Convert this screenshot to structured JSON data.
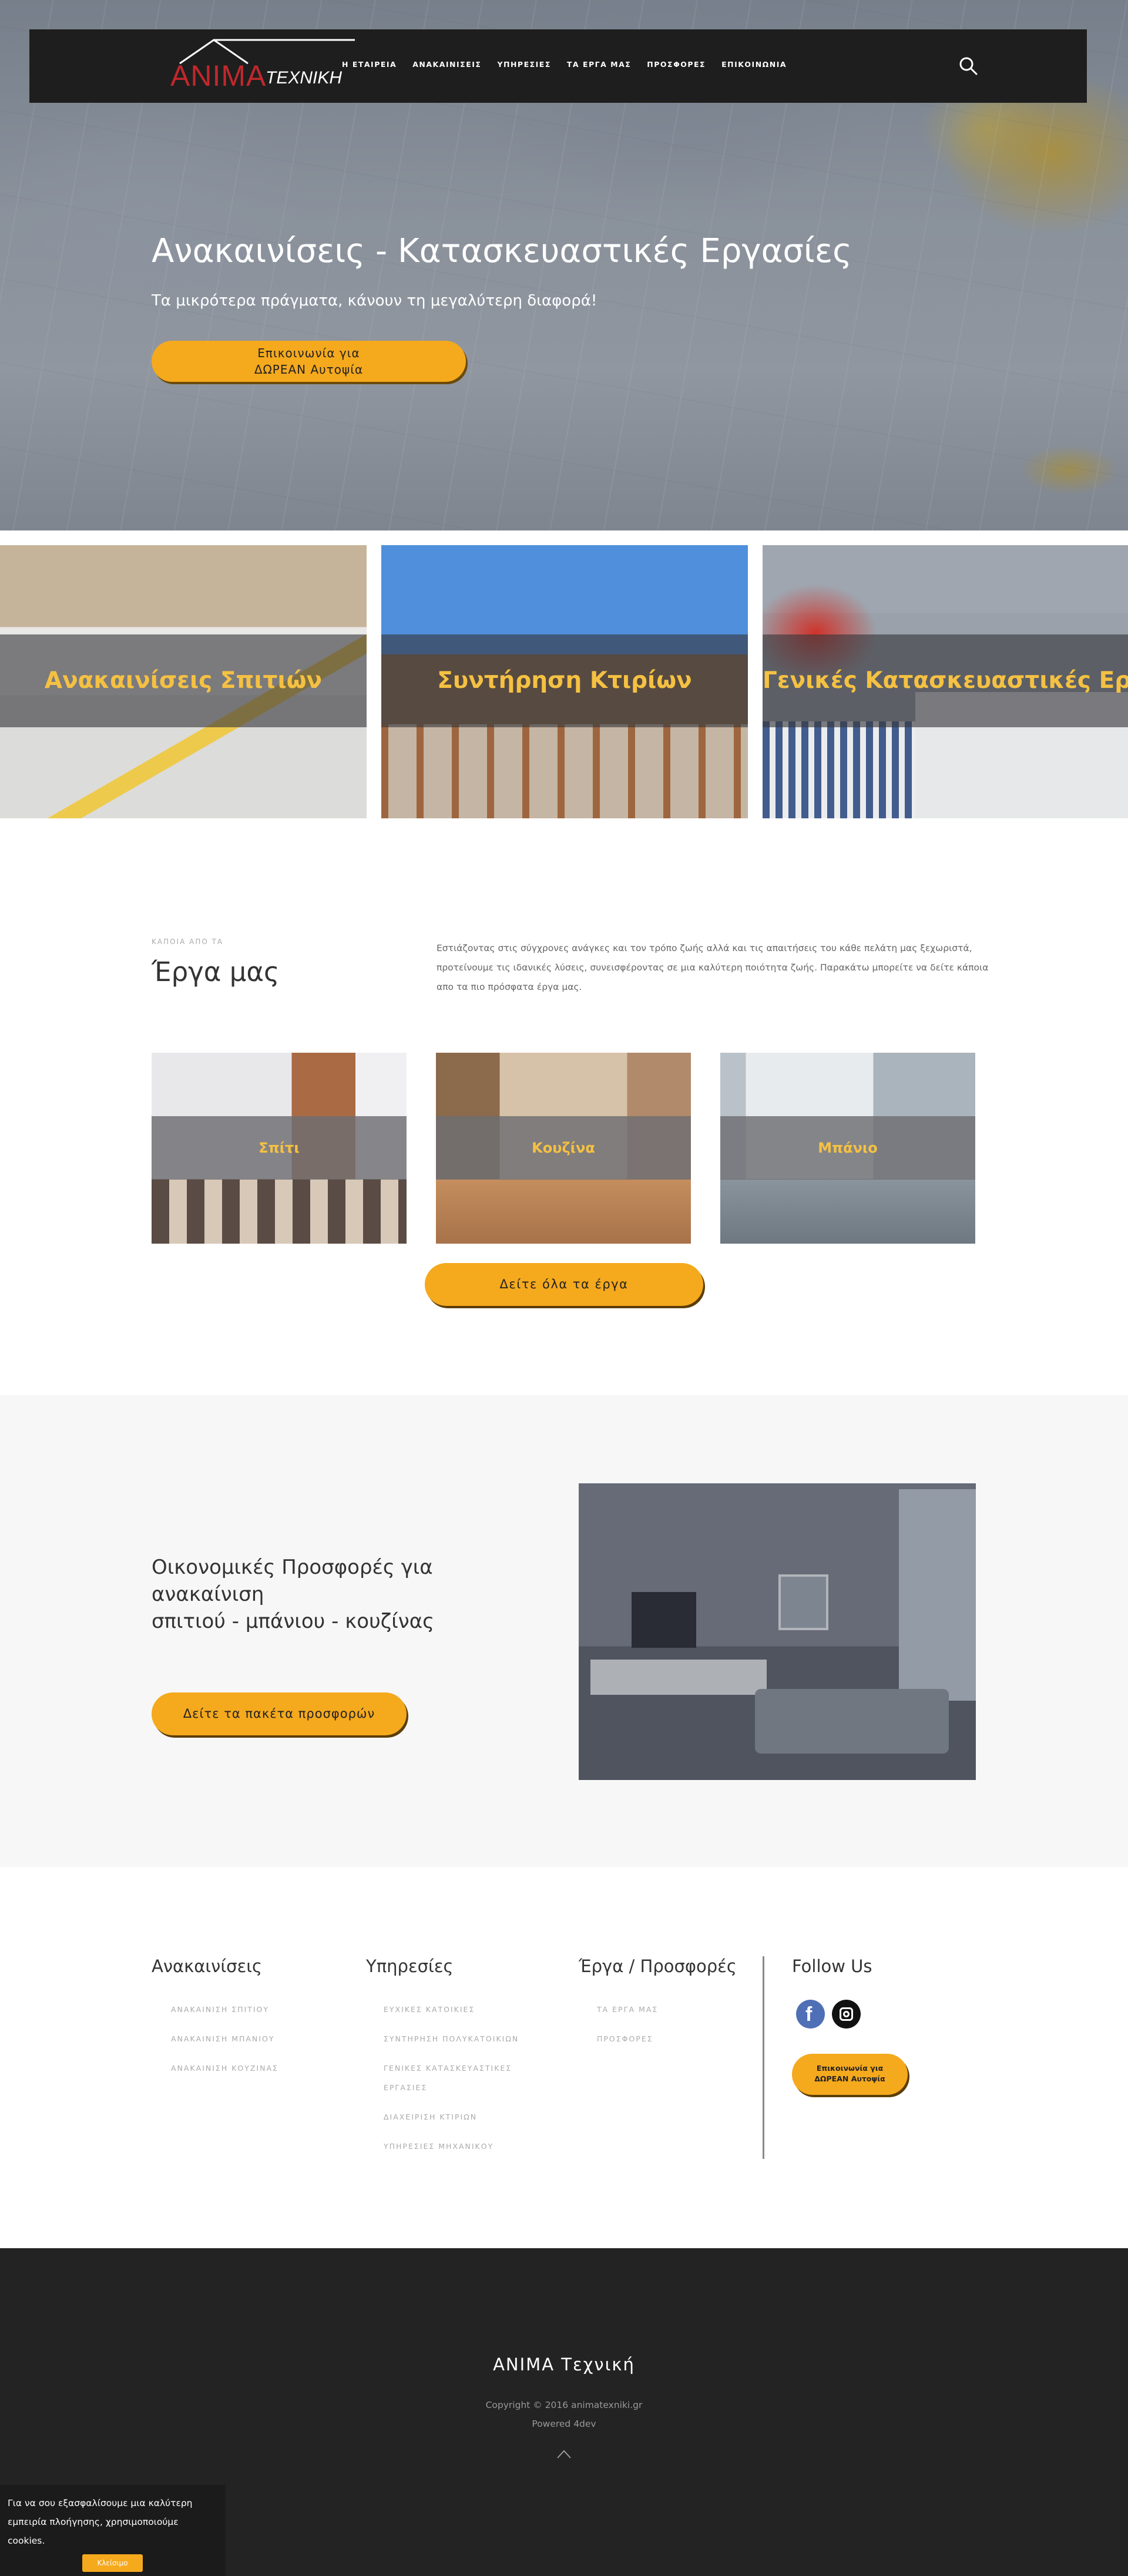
{
  "header": {
    "logo_main": "ANIMA",
    "logo_sub": "ΤΕΧΝΙΚΗ",
    "nav": [
      "Η ΕΤΑΙΡΕΙΑ",
      "ΑΝΑΚΑΙΝΙΣΕΙΣ",
      "ΥΠΗΡΕΣΙΕΣ",
      "ΤΑ ΕΡΓΑ ΜΑΣ",
      "ΠΡΟΣΦΟΡΕΣ",
      "ΕΠΙΚΟΙΝΩΝΙΑ"
    ],
    "search_icon": "search-icon"
  },
  "hero": {
    "title": "Ανακαινίσεις - Κατασκευαστικές Εργασίες",
    "subtitle": "Τα μικρότερα πράγματα, κάνουν τη μεγαλύτερη διαφορά!",
    "cta_line1": "Επικοινωνία για",
    "cta_line2": "ΔΩΡΕΑΝ Αυτοψία"
  },
  "services": [
    {
      "label": "Ανακαινίσεις Σπιτιών"
    },
    {
      "label": "Συντήρηση Κτιρίων"
    },
    {
      "label": "Γενικές Κατασκευαστικές Εργασίες"
    }
  ],
  "projects": {
    "kicker": "ΚΑΠΟΙΑ ΑΠΟ ΤΑ",
    "title": "Έργα μας",
    "description": "Εστιάζοντας στις σύγχρονες ανάγκες και τον τρόπο ζωής αλλά και τις απαιτήσεις του κάθε πελάτη μας ξεχωριστά, προτείνουμε τις ιδανικές λύσεις, συνεισφέροντας σε μια καλύτερη ποιότητα ζωής. Παρακάτω μπορείτε να δείτε κάποια απο τα πιο πρόσφατα έργα μας.",
    "items": [
      {
        "label": "Σπίτι"
      },
      {
        "label": "Κουζίνα"
      },
      {
        "label": "Μπάνιο"
      }
    ],
    "button": "Δείτε όλα τα έργα"
  },
  "offers": {
    "title_line1": "Οικονομικές Προσφορές για",
    "title_line2": "ανακαίνιση",
    "title_line3": "σπιτιού - μπάνιου - κουζίνας",
    "button": "Δείτε τα πακέτα προσφορών"
  },
  "footer_links": {
    "columns": [
      {
        "title": "Ανακαινίσεις",
        "links": [
          "ΑΝΑΚΑΙΝΙΣΗ ΣΠΙΤΙΟΥ",
          "ΑΝΑΚΑΙΝΙΣΗ ΜΠΑΝΙΟΥ",
          "ΑΝΑΚΑΙΝΙΣΗ ΚΟΥΖΙΝΑΣ"
        ]
      },
      {
        "title": "Υπηρεσίες",
        "links": [
          "ΕΥΧΙΚΕΣ ΚΑΤΟΙΚΙΕΣ",
          "ΣΥΝΤΗΡΗΣΗ ΠΟΛΥΚΑΤΟΙΚΙΩΝ",
          "ΓΕΝΙΚΕΣ ΚΑΤΑΣΚΕΥΑΣΤΙΚΕΣ",
          "ΕΡΓΑΣΙΕΣ",
          "ΔΙΑΧΕΙΡΙΣΗ ΚΤΙΡΙΩΝ",
          "ΥΠΗΡΕΣΙΕΣ ΜΗΧΑΝΙΚΟΥ"
        ]
      },
      {
        "title": "Έργα / Προσφορές",
        "links": [
          "ΤΑ ΕΡΓΑ ΜΑΣ",
          "ΠΡΟΣΦΟΡΕΣ"
        ]
      }
    ],
    "follow_title": "Follow Us",
    "social": [
      "facebook-icon",
      "instagram-icon"
    ],
    "cta_line1": "Επικοινωνία για",
    "cta_line2": "ΔΩΡΕΑΝ Αυτοψία"
  },
  "footer": {
    "brand": "ANIMA Τεχνική",
    "copyright": "Copyright © 2016 animatexniki.gr",
    "powered": "Powered 4dev",
    "up_icon": "chevron-up-icon"
  },
  "cookie": {
    "text": "Για να σου εξασφαλίσουμε μια καλύτερη εμπειρία πλοήγησης, χρησιμοποιούμε cookies.",
    "button": "Κλείσιμο"
  },
  "colors": {
    "accent": "#f5a91d",
    "label_yellow": "#f5c142",
    "logo_red": "#c0282c",
    "dark": "#1e1e1e"
  }
}
